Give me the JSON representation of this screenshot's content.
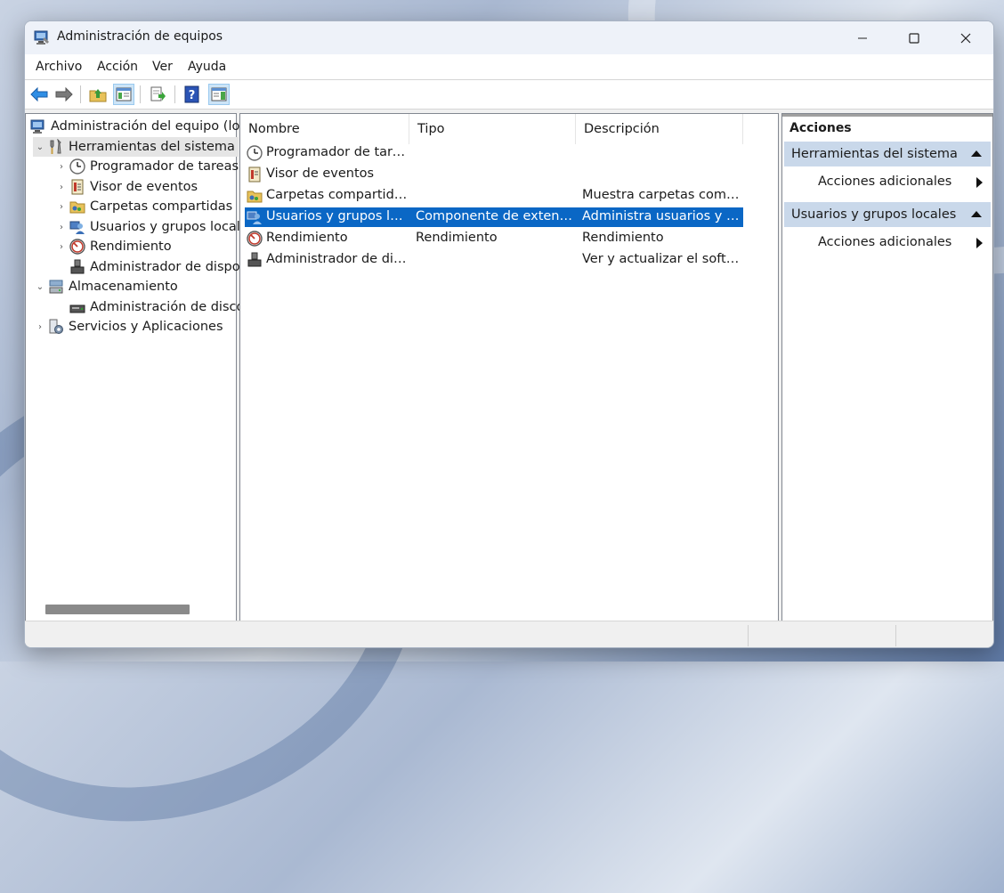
{
  "window": {
    "title": "Administración de equipos",
    "icons": {
      "app": "computer-management-icon",
      "minimize": "minimize-icon",
      "maximize": "maximize-icon",
      "close": "close-icon"
    }
  },
  "menu": {
    "items": [
      "Archivo",
      "Acción",
      "Ver",
      "Ayuda"
    ]
  },
  "toolbar": {
    "buttons": [
      "back-arrow-icon",
      "forward-arrow-icon",
      "up-folder-icon",
      "show-hide-tree-icon",
      "export-list-icon",
      "help-icon",
      "show-hide-action-pane-icon"
    ]
  },
  "tree": {
    "root": "Administración del equipo (loca",
    "items": [
      {
        "label": "Herramientas del sistema",
        "icon": "tools-icon"
      },
      {
        "label": "Programador de tareas",
        "icon": "clock-icon"
      },
      {
        "label": "Visor de eventos",
        "icon": "event-viewer-icon"
      },
      {
        "label": "Carpetas compartidas",
        "icon": "shared-folder-icon"
      },
      {
        "label": "Usuarios y grupos locale",
        "icon": "users-icon"
      },
      {
        "label": "Rendimiento",
        "icon": "performance-icon"
      },
      {
        "label": "Administrador de dispos",
        "icon": "device-manager-icon"
      },
      {
        "label": "Almacenamiento",
        "icon": "storage-icon"
      },
      {
        "label": "Administración de disco",
        "icon": "disk-icon"
      },
      {
        "label": "Servicios y Aplicaciones",
        "icon": "services-icon"
      }
    ]
  },
  "list": {
    "columns": [
      "Nombre",
      "Tipo",
      "Descripción"
    ],
    "rows": [
      {
        "name": "Programador de tareas",
        "type": "",
        "desc": "",
        "icon": "clock-icon"
      },
      {
        "name": "Visor de eventos",
        "type": "",
        "desc": "",
        "icon": "event-viewer-icon"
      },
      {
        "name": "Carpetas compartidas",
        "type": "",
        "desc": "Muestra carpetas compa...",
        "icon": "shared-folder-icon"
      },
      {
        "name": "Usuarios y grupos loca...",
        "type": "Componente de extensión",
        "desc": "Administra usuarios y gr...",
        "icon": "users-icon",
        "selected": true
      },
      {
        "name": "Rendimiento",
        "type": "Rendimiento",
        "desc": "Rendimiento",
        "icon": "performance-icon"
      },
      {
        "name": "Administrador de disp...",
        "type": "",
        "desc": "Ver y actualizar el softwar...",
        "icon": "device-manager-icon"
      }
    ]
  },
  "actions": {
    "title": "Acciones",
    "sections": [
      {
        "label": "Herramientas del sistema",
        "item": "Acciones adicionales"
      },
      {
        "label": "Usuarios y grupos locales",
        "item": "Acciones adicionales"
      }
    ]
  },
  "colors": {
    "selection": "#0a67c5",
    "section_bg": "#c9d8ea",
    "toolbar_active": "#cce4f7"
  }
}
